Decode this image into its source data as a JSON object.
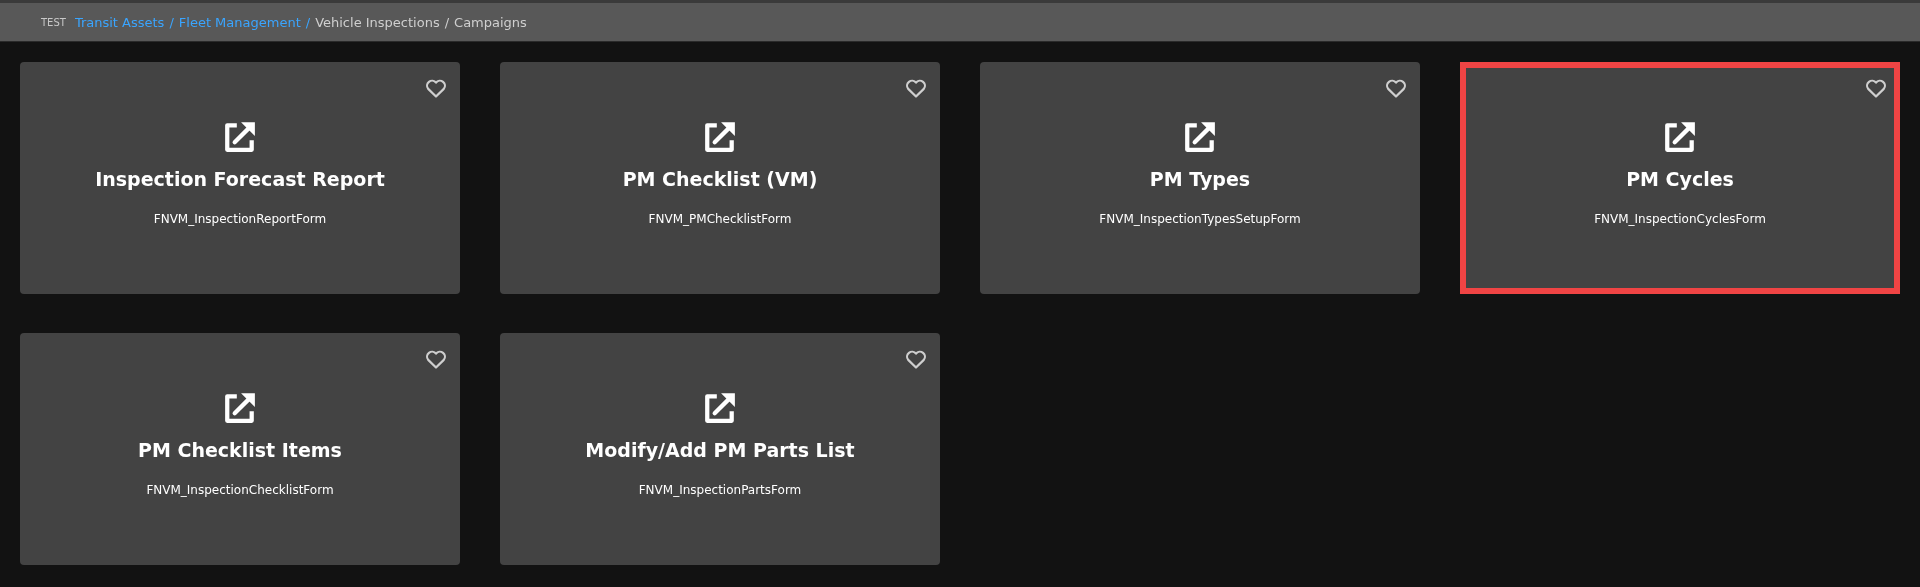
{
  "breadcrumb": {
    "environment": "TEST",
    "separator": "/",
    "items": [
      {
        "label": "Transit Assets",
        "link": true
      },
      {
        "label": "Fleet Management",
        "link": true
      },
      {
        "label": "Vehicle Inspections",
        "link": false
      },
      {
        "label": "Campaigns",
        "link": false
      }
    ]
  },
  "cards": [
    {
      "title": "Inspection Forecast Report",
      "form": "FNVM_InspectionReportForm",
      "favorite": false,
      "highlighted": false
    },
    {
      "title": "PM Checklist (VM)",
      "form": "FNVM_PMChecklistForm",
      "favorite": false,
      "highlighted": false
    },
    {
      "title": "PM Types",
      "form": "FNVM_InspectionTypesSetupForm",
      "favorite": false,
      "highlighted": false
    },
    {
      "title": "PM Cycles",
      "form": "FNVM_InspectionCyclesForm",
      "favorite": false,
      "highlighted": true
    },
    {
      "title": "PM Checklist Items",
      "form": "FNVM_InspectionChecklistForm",
      "favorite": false,
      "highlighted": false
    },
    {
      "title": "Modify/Add PM Parts List",
      "form": "FNVM_InspectionPartsForm",
      "favorite": false,
      "highlighted": false
    }
  ]
}
